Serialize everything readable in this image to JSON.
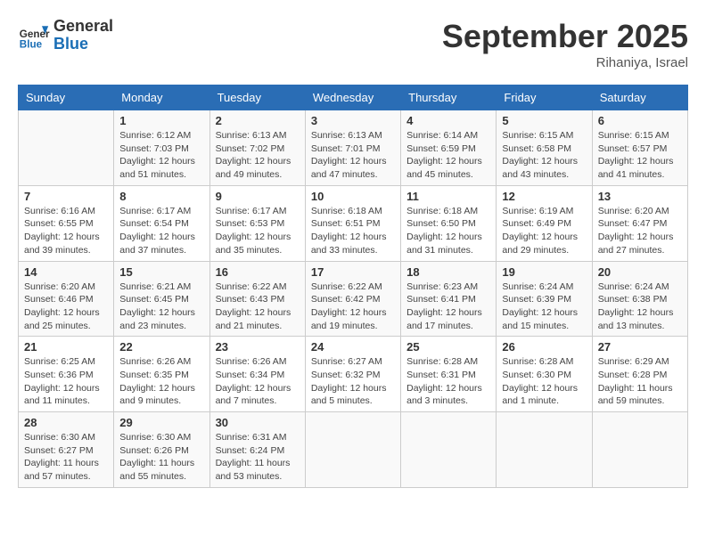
{
  "header": {
    "logo_line1": "General",
    "logo_line2": "Blue",
    "title": "September 2025",
    "location": "Rihaniya, Israel"
  },
  "days_of_week": [
    "Sunday",
    "Monday",
    "Tuesday",
    "Wednesday",
    "Thursday",
    "Friday",
    "Saturday"
  ],
  "weeks": [
    [
      {
        "day": "",
        "info": ""
      },
      {
        "day": "1",
        "info": "Sunrise: 6:12 AM\nSunset: 7:03 PM\nDaylight: 12 hours\nand 51 minutes."
      },
      {
        "day": "2",
        "info": "Sunrise: 6:13 AM\nSunset: 7:02 PM\nDaylight: 12 hours\nand 49 minutes."
      },
      {
        "day": "3",
        "info": "Sunrise: 6:13 AM\nSunset: 7:01 PM\nDaylight: 12 hours\nand 47 minutes."
      },
      {
        "day": "4",
        "info": "Sunrise: 6:14 AM\nSunset: 6:59 PM\nDaylight: 12 hours\nand 45 minutes."
      },
      {
        "day": "5",
        "info": "Sunrise: 6:15 AM\nSunset: 6:58 PM\nDaylight: 12 hours\nand 43 minutes."
      },
      {
        "day": "6",
        "info": "Sunrise: 6:15 AM\nSunset: 6:57 PM\nDaylight: 12 hours\nand 41 minutes."
      }
    ],
    [
      {
        "day": "7",
        "info": "Sunrise: 6:16 AM\nSunset: 6:55 PM\nDaylight: 12 hours\nand 39 minutes."
      },
      {
        "day": "8",
        "info": "Sunrise: 6:17 AM\nSunset: 6:54 PM\nDaylight: 12 hours\nand 37 minutes."
      },
      {
        "day": "9",
        "info": "Sunrise: 6:17 AM\nSunset: 6:53 PM\nDaylight: 12 hours\nand 35 minutes."
      },
      {
        "day": "10",
        "info": "Sunrise: 6:18 AM\nSunset: 6:51 PM\nDaylight: 12 hours\nand 33 minutes."
      },
      {
        "day": "11",
        "info": "Sunrise: 6:18 AM\nSunset: 6:50 PM\nDaylight: 12 hours\nand 31 minutes."
      },
      {
        "day": "12",
        "info": "Sunrise: 6:19 AM\nSunset: 6:49 PM\nDaylight: 12 hours\nand 29 minutes."
      },
      {
        "day": "13",
        "info": "Sunrise: 6:20 AM\nSunset: 6:47 PM\nDaylight: 12 hours\nand 27 minutes."
      }
    ],
    [
      {
        "day": "14",
        "info": "Sunrise: 6:20 AM\nSunset: 6:46 PM\nDaylight: 12 hours\nand 25 minutes."
      },
      {
        "day": "15",
        "info": "Sunrise: 6:21 AM\nSunset: 6:45 PM\nDaylight: 12 hours\nand 23 minutes."
      },
      {
        "day": "16",
        "info": "Sunrise: 6:22 AM\nSunset: 6:43 PM\nDaylight: 12 hours\nand 21 minutes."
      },
      {
        "day": "17",
        "info": "Sunrise: 6:22 AM\nSunset: 6:42 PM\nDaylight: 12 hours\nand 19 minutes."
      },
      {
        "day": "18",
        "info": "Sunrise: 6:23 AM\nSunset: 6:41 PM\nDaylight: 12 hours\nand 17 minutes."
      },
      {
        "day": "19",
        "info": "Sunrise: 6:24 AM\nSunset: 6:39 PM\nDaylight: 12 hours\nand 15 minutes."
      },
      {
        "day": "20",
        "info": "Sunrise: 6:24 AM\nSunset: 6:38 PM\nDaylight: 12 hours\nand 13 minutes."
      }
    ],
    [
      {
        "day": "21",
        "info": "Sunrise: 6:25 AM\nSunset: 6:36 PM\nDaylight: 12 hours\nand 11 minutes."
      },
      {
        "day": "22",
        "info": "Sunrise: 6:26 AM\nSunset: 6:35 PM\nDaylight: 12 hours\nand 9 minutes."
      },
      {
        "day": "23",
        "info": "Sunrise: 6:26 AM\nSunset: 6:34 PM\nDaylight: 12 hours\nand 7 minutes."
      },
      {
        "day": "24",
        "info": "Sunrise: 6:27 AM\nSunset: 6:32 PM\nDaylight: 12 hours\nand 5 minutes."
      },
      {
        "day": "25",
        "info": "Sunrise: 6:28 AM\nSunset: 6:31 PM\nDaylight: 12 hours\nand 3 minutes."
      },
      {
        "day": "26",
        "info": "Sunrise: 6:28 AM\nSunset: 6:30 PM\nDaylight: 12 hours\nand 1 minute."
      },
      {
        "day": "27",
        "info": "Sunrise: 6:29 AM\nSunset: 6:28 PM\nDaylight: 11 hours\nand 59 minutes."
      }
    ],
    [
      {
        "day": "28",
        "info": "Sunrise: 6:30 AM\nSunset: 6:27 PM\nDaylight: 11 hours\nand 57 minutes."
      },
      {
        "day": "29",
        "info": "Sunrise: 6:30 AM\nSunset: 6:26 PM\nDaylight: 11 hours\nand 55 minutes."
      },
      {
        "day": "30",
        "info": "Sunrise: 6:31 AM\nSunset: 6:24 PM\nDaylight: 11 hours\nand 53 minutes."
      },
      {
        "day": "",
        "info": ""
      },
      {
        "day": "",
        "info": ""
      },
      {
        "day": "",
        "info": ""
      },
      {
        "day": "",
        "info": ""
      }
    ]
  ]
}
